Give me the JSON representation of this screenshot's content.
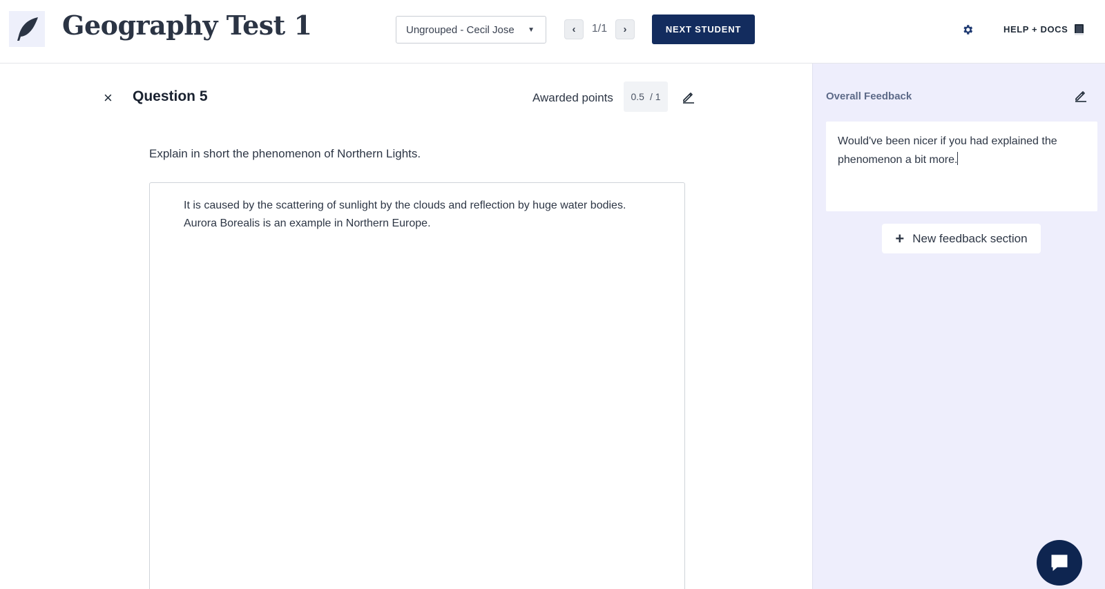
{
  "header": {
    "title": "Geography Test 1",
    "student_select": "Ungrouped - Cecil Jose",
    "pager": {
      "prev": "‹",
      "count": "1/1",
      "next": "›"
    },
    "next_student_label": "NEXT STUDENT",
    "help_label": "HELP + DOCS"
  },
  "question": {
    "close": "×",
    "title": "Question 5",
    "awarded_label": "Awarded points",
    "points_awarded": "0.5",
    "points_total": "/ 1",
    "prompt": "Explain in short the phenomenon of Northern Lights.",
    "answer": "It is caused by the scattering of sunlight by the clouds and reflection by huge water bodies. Aurora Borealis is an example in Northern Europe."
  },
  "feedback": {
    "title": "Overall Feedback",
    "text": "Would've been nicer if you had explained the phenomenon a bit more.",
    "new_section_label": "New feedback section",
    "plus": "+"
  },
  "icons": {
    "logo": "feather-icon",
    "settings": "gear-icon",
    "docs": "book-icon",
    "edit": "pencil-icon",
    "chat": "chat-icon"
  },
  "colors": {
    "primary": "#132c5e",
    "sidebar_bg": "#eeeefc",
    "chat_bg": "#0e2550"
  }
}
